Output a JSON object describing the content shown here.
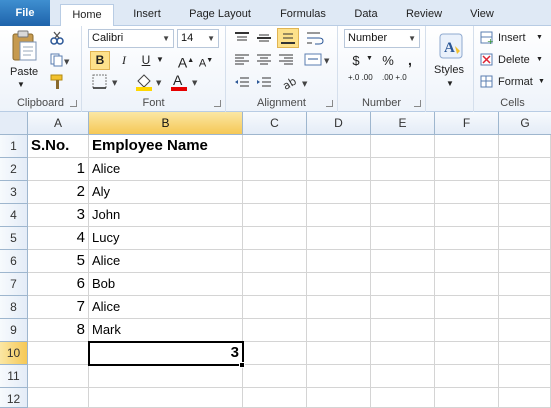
{
  "tabs": [
    "File",
    "Home",
    "Insert",
    "Page Layout",
    "Formulas",
    "Data",
    "Review",
    "View"
  ],
  "active_tab": "Home",
  "ribbon": {
    "clipboard": {
      "label": "Clipboard",
      "paste": "Paste"
    },
    "font": {
      "label": "Font",
      "name": "Calibri",
      "size": "14",
      "bold": "B",
      "italic": "I",
      "underline": "U",
      "grow": "A",
      "shrink": "A",
      "color_letter": "A"
    },
    "alignment": {
      "label": "Alignment"
    },
    "number": {
      "label": "Number",
      "format": "Number",
      "currency": "$",
      "percent": "%",
      "comma": ",",
      "inc_decimal": "+.0 .00",
      "dec_decimal": ".00 +.0"
    },
    "styles": {
      "label": "Styles"
    },
    "cells": {
      "label": "Cells",
      "insert": "Insert",
      "delete": "Delete",
      "format": "Format"
    }
  },
  "columns": [
    "A",
    "B",
    "C",
    "D",
    "E",
    "F",
    "G"
  ],
  "selected_column": "B",
  "rows": [
    "1",
    "2",
    "3",
    "4",
    "5",
    "6",
    "7",
    "8",
    "9",
    "10",
    "11",
    "12"
  ],
  "selected_row": "10",
  "header_row": {
    "a": "S.No.",
    "b": "Employee Name"
  },
  "data_rows": [
    {
      "a": "1",
      "b": "Alice"
    },
    {
      "a": "2",
      "b": "Aly"
    },
    {
      "a": "3",
      "b": "John"
    },
    {
      "a": "4",
      "b": "Lucy"
    },
    {
      "a": "5",
      "b": "Alice"
    },
    {
      "a": "6",
      "b": "Bob"
    },
    {
      "a": "7",
      "b": "Alice"
    },
    {
      "a": "8",
      "b": "Mark"
    }
  ],
  "active_cell": {
    "ref": "B10",
    "value": "3"
  },
  "colors": {
    "accent": "#1e63ab",
    "fill_yellow": "#ffd700",
    "font_red": "#e60000",
    "selection_header": "#f5c856"
  }
}
